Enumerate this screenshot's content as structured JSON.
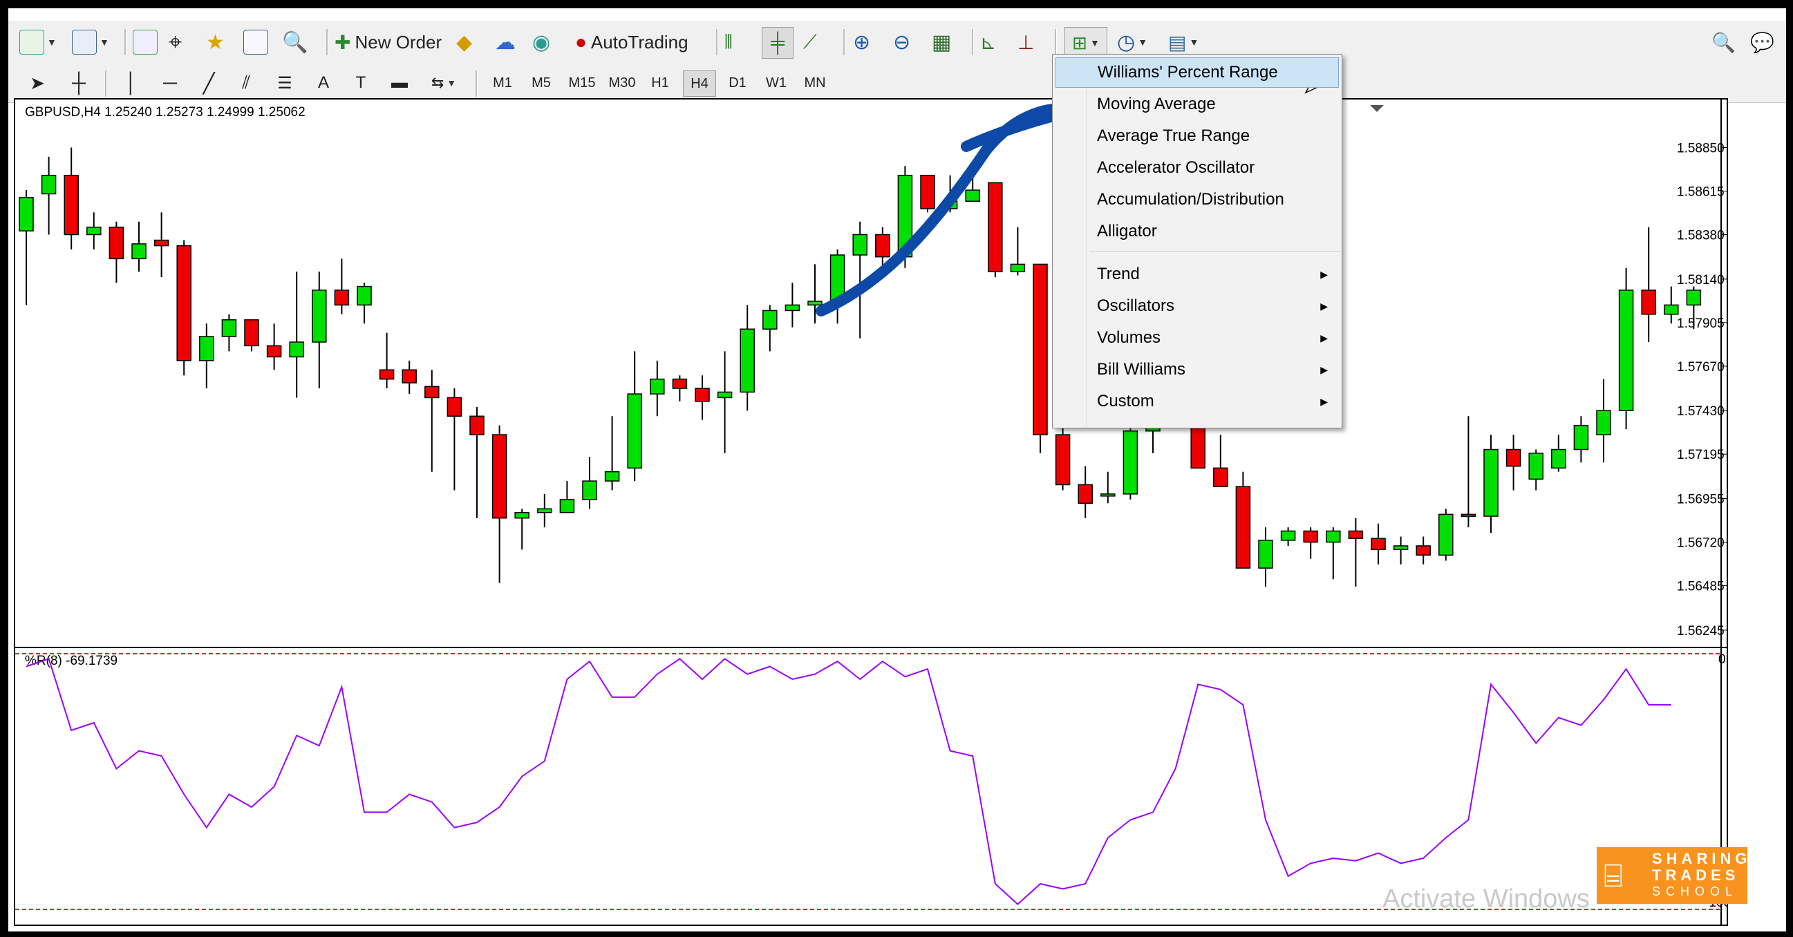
{
  "toolbar": {
    "new_order_label": "New Order",
    "autotrading_label": "AutoTrading",
    "timeframes": [
      "M1",
      "M5",
      "M15",
      "M30",
      "H1",
      "H4",
      "D1",
      "W1",
      "MN"
    ],
    "selected_timeframe": "H4"
  },
  "chart": {
    "symbol_info": "GBPUSD,H4  1.25240 1.25273 1.24999 1.25062",
    "price_axis": [
      "1.58850",
      "1.58615",
      "1.58380",
      "1.58140",
      "1.57905",
      "1.57670",
      "1.57430",
      "1.57195",
      "1.56955",
      "1.56720",
      "1.56485",
      "1.56245"
    ],
    "up_color": "#00e000",
    "down_color": "#ee0000"
  },
  "indicator": {
    "info": "%R(8) -69.1739",
    "axis_top": "0",
    "axis_bottom": "-100",
    "line_color": "#9b00ff"
  },
  "menu": {
    "items": [
      {
        "label": "Williams' Percent Range",
        "submenu": false,
        "highlighted": true
      },
      {
        "label": "Moving Average",
        "submenu": false
      },
      {
        "label": "Average True Range",
        "submenu": false
      },
      {
        "label": "Accelerator Oscillator",
        "submenu": false
      },
      {
        "label": "Accumulation/Distribution",
        "submenu": false
      },
      {
        "label": "Alligator",
        "submenu": false
      },
      {
        "label": "Trend",
        "submenu": true
      },
      {
        "label": "Oscillators",
        "submenu": true
      },
      {
        "label": "Volumes",
        "submenu": true
      },
      {
        "label": "Bill Williams",
        "submenu": true
      },
      {
        "label": "Custom",
        "submenu": true
      }
    ]
  },
  "watermark": "Activate Windows",
  "logo": {
    "line1": "SHARING",
    "line2": "TRADES",
    "line3": "SCHOOL"
  },
  "chart_data": {
    "type": "candlestick",
    "candles_ohlc": [
      [
        1.584,
        1.5862,
        1.58,
        1.5858
      ],
      [
        1.586,
        1.588,
        1.5838,
        1.587
      ],
      [
        1.587,
        1.5885,
        1.583,
        1.5838
      ],
      [
        1.5838,
        1.585,
        1.583,
        1.5842
      ],
      [
        1.5842,
        1.5845,
        1.5812,
        1.5825
      ],
      [
        1.5825,
        1.5845,
        1.5818,
        1.5833
      ],
      [
        1.5835,
        1.585,
        1.5815,
        1.5832
      ],
      [
        1.5832,
        1.5835,
        1.5762,
        1.577
      ],
      [
        1.577,
        1.579,
        1.5755,
        1.5783
      ],
      [
        1.5783,
        1.5795,
        1.5775,
        1.5792
      ],
      [
        1.5792,
        1.5792,
        1.5775,
        1.5778
      ],
      [
        1.5778,
        1.579,
        1.5765,
        1.5772
      ],
      [
        1.5772,
        1.5818,
        1.575,
        1.578
      ],
      [
        1.578,
        1.5818,
        1.5755,
        1.5808
      ],
      [
        1.5808,
        1.5825,
        1.5795,
        1.58
      ],
      [
        1.58,
        1.5812,
        1.579,
        1.581
      ],
      [
        1.5765,
        1.5785,
        1.5755,
        1.576
      ],
      [
        1.5765,
        1.577,
        1.5752,
        1.5758
      ],
      [
        1.5756,
        1.5765,
        1.571,
        1.575
      ],
      [
        1.575,
        1.5755,
        1.57,
        1.574
      ],
      [
        1.574,
        1.5745,
        1.5685,
        1.573
      ],
      [
        1.573,
        1.5735,
        1.565,
        1.5685
      ],
      [
        1.5685,
        1.569,
        1.5668,
        1.5688
      ],
      [
        1.5688,
        1.5698,
        1.568,
        1.569
      ],
      [
        1.5688,
        1.5705,
        1.5688,
        1.5695
      ],
      [
        1.5695,
        1.5718,
        1.569,
        1.5705
      ],
      [
        1.5705,
        1.574,
        1.57,
        1.571
      ],
      [
        1.5712,
        1.5775,
        1.5705,
        1.5752
      ],
      [
        1.5752,
        1.577,
        1.574,
        1.576
      ],
      [
        1.576,
        1.5762,
        1.5748,
        1.5755
      ],
      [
        1.5755,
        1.5762,
        1.5738,
        1.5748
      ],
      [
        1.575,
        1.5775,
        1.572,
        1.5753
      ],
      [
        1.5753,
        1.58,
        1.5743,
        1.5787
      ],
      [
        1.5787,
        1.58,
        1.5775,
        1.5797
      ],
      [
        1.5797,
        1.5812,
        1.5788,
        1.58
      ],
      [
        1.58,
        1.5822,
        1.579,
        1.5802
      ],
      [
        1.5802,
        1.583,
        1.579,
        1.5827
      ],
      [
        1.5827,
        1.5845,
        1.5782,
        1.5838
      ],
      [
        1.5838,
        1.5842,
        1.582,
        1.5826
      ],
      [
        1.5826,
        1.5875,
        1.582,
        1.587
      ],
      [
        1.587,
        1.587,
        1.585,
        1.5852
      ],
      [
        1.5852,
        1.587,
        1.585,
        1.5856
      ],
      [
        1.5856,
        1.5875,
        1.5856,
        1.5862
      ],
      [
        1.5866,
        1.5866,
        1.5815,
        1.5818
      ],
      [
        1.5818,
        1.5842,
        1.5816,
        1.5822
      ],
      [
        1.5822,
        1.5822,
        1.572,
        1.573
      ],
      [
        1.573,
        1.5734,
        1.57,
        1.5703
      ],
      [
        1.5703,
        1.5713,
        1.5685,
        1.5693
      ],
      [
        1.5698,
        1.571,
        1.5693,
        1.5698
      ],
      [
        1.5698,
        1.574,
        1.5695,
        1.5732
      ],
      [
        1.5732,
        1.5752,
        1.572,
        1.575
      ],
      [
        1.575,
        1.5755,
        1.574,
        1.5745
      ],
      [
        1.5735,
        1.5745,
        1.5715,
        1.5712
      ],
      [
        1.5712,
        1.573,
        1.5705,
        1.5702
      ],
      [
        1.5702,
        1.571,
        1.566,
        1.5658
      ],
      [
        1.5658,
        1.568,
        1.5648,
        1.5673
      ],
      [
        1.5673,
        1.568,
        1.567,
        1.5678
      ],
      [
        1.5678,
        1.568,
        1.5663,
        1.5672
      ],
      [
        1.5672,
        1.568,
        1.5652,
        1.5678
      ],
      [
        1.5678,
        1.5685,
        1.5648,
        1.5674
      ],
      [
        1.5674,
        1.5682,
        1.566,
        1.5668
      ],
      [
        1.5668,
        1.5675,
        1.566,
        1.567
      ],
      [
        1.567,
        1.5675,
        1.566,
        1.5665
      ],
      [
        1.5665,
        1.569,
        1.5662,
        1.5687
      ],
      [
        1.5687,
        1.574,
        1.568,
        1.5686
      ],
      [
        1.5686,
        1.573,
        1.5677,
        1.5722
      ],
      [
        1.5722,
        1.573,
        1.57,
        1.5713
      ],
      [
        1.5706,
        1.5722,
        1.57,
        1.572
      ],
      [
        1.5712,
        1.573,
        1.571,
        1.5722
      ],
      [
        1.5722,
        1.574,
        1.5715,
        1.5735
      ],
      [
        1.573,
        1.576,
        1.5715,
        1.5743
      ],
      [
        1.5743,
        1.582,
        1.5733,
        1.5808
      ],
      [
        1.5808,
        1.5842,
        1.578,
        1.5795
      ],
      [
        1.5795,
        1.581,
        1.579,
        1.58
      ],
      [
        1.58,
        1.581,
        1.5787,
        1.5808
      ]
    ],
    "williams_r": [
      -5,
      -2,
      -30,
      -27,
      -45,
      -38,
      -40,
      -55,
      -68,
      -55,
      -60,
      -52,
      -32,
      -36,
      -13,
      -62,
      -62,
      -55,
      -58,
      -68,
      -66,
      -60,
      -48,
      -42,
      -10,
      -3,
      -17,
      -17,
      -8,
      -2,
      -10,
      -2,
      -8,
      -5,
      -10,
      -8,
      -3,
      -10,
      -3,
      -9,
      -6,
      -38,
      -40,
      -90,
      -98,
      -90,
      -92,
      -90,
      -72,
      -65,
      -62,
      -45,
      -12,
      -14,
      -20,
      -65,
      -87,
      -82,
      -80,
      -81,
      -78,
      -82,
      -80,
      -72,
      -65,
      -12,
      -23,
      -35,
      -25,
      -28,
      -18,
      -6,
      -20,
      -20
    ]
  }
}
